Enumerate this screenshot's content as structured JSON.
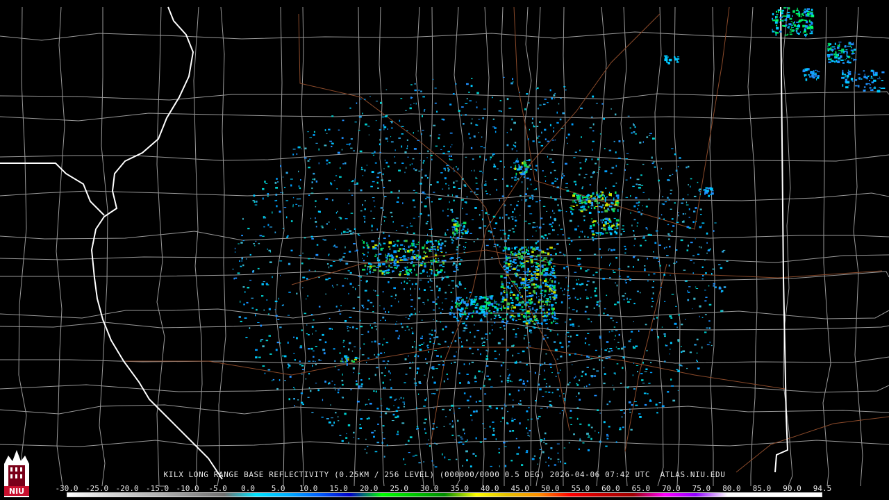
{
  "product": {
    "station": "KILX",
    "title_line": "KILX LONG RANGE BASE REFLECTIVITY (0.25KM / 256 LEVEL) (000000/0000 0.5 DEG) 2026-04-06 07:42 UTC  ATLAS.NIU.EDU"
  },
  "logo": {
    "text": "NIU",
    "icon": "university-tower-icon"
  },
  "colorbar": {
    "ticks": [
      "-30.0",
      "-25.0",
      "-20.0",
      "-15.0",
      "-10.0",
      "-5.0",
      "0.0",
      "5.0",
      "10.0",
      "15.0",
      "20.0",
      "25.0",
      "30.0",
      "35.0",
      "40.0",
      "45.0",
      "50.0",
      "55.0",
      "60.0",
      "65.0",
      "70.0",
      "75.0",
      "80.0",
      "85.0",
      "90.0",
      "94.5"
    ],
    "colors": [
      "#ffffff",
      "#e0e0e0",
      "#c8c8c8",
      "#b0b0b0",
      "#909090",
      "#707070",
      "#00e5ff",
      "#00b0ff",
      "#0060ff",
      "#0000c8",
      "#00ff00",
      "#00c800",
      "#008c00",
      "#ffff00",
      "#e6c000",
      "#ff9000",
      "#ff0000",
      "#c80000",
      "#a00000",
      "#ff00ff",
      "#9000ff",
      "#ffffff",
      "#ffffff",
      "#ffffff",
      "#ffffff"
    ]
  },
  "map_colors": {
    "background": "#000000",
    "county_lines": "#9a9a9a",
    "state_lines": "#ffffff",
    "roads": "#8b4a2a"
  }
}
